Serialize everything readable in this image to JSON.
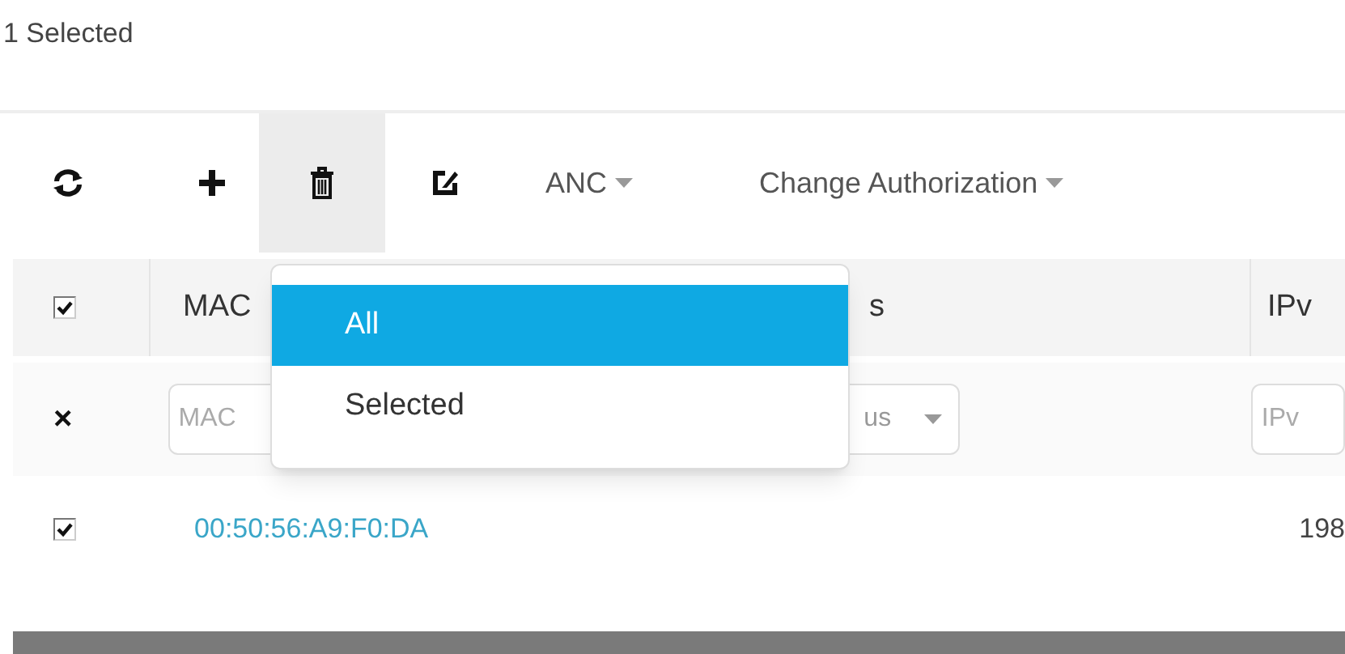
{
  "selection_count": "1 Selected",
  "toolbar": [
    {
      "kind": "refresh",
      "active": false
    },
    {
      "kind": "add",
      "active": false
    },
    {
      "kind": "trash",
      "active": true
    },
    {
      "kind": "edit",
      "active": false
    },
    {
      "kind": "menu",
      "label": "ANC",
      "active": false
    },
    {
      "kind": "menu",
      "label": "Change Authorization",
      "active": false
    }
  ],
  "delete_menu": [
    {
      "label": "All",
      "selected": true
    },
    {
      "label": "Selected",
      "selected": false
    }
  ],
  "table": {
    "header_checked": true,
    "columns": [
      "MAC",
      "s",
      "IPv"
    ],
    "filter_clear": "×",
    "filters": [
      {
        "kind": "text",
        "placeholder": "MAC"
      },
      {
        "kind": "select",
        "placeholder": "us"
      },
      {
        "kind": "text",
        "placeholder": "IPv"
      }
    ],
    "rows": [
      {
        "checked": true,
        "mac": "00:50:56:A9:F0:DA",
        "column_3": "198"
      }
    ]
  }
}
